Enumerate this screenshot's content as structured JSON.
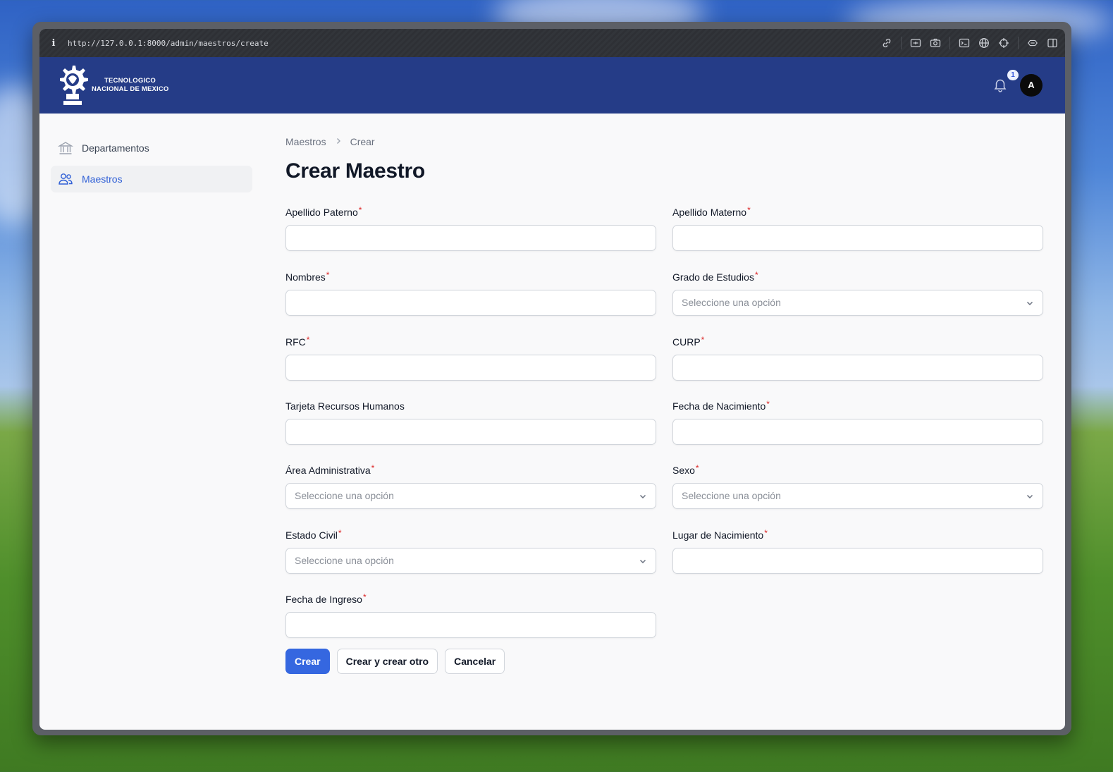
{
  "browser": {
    "url": "http://127.0.0.1:8000/admin/maestros/create",
    "info_icon": "i"
  },
  "header": {
    "logo_line1": "TECNOLOGICO",
    "logo_line2": "NACIONAL DE MEXICO",
    "notification_count": "1",
    "avatar_initial": "A",
    "brand_color": "#253c87"
  },
  "sidebar": {
    "items": [
      {
        "label": "Departamentos",
        "icon": "building-columns-icon",
        "active": false
      },
      {
        "label": "Maestros",
        "icon": "users-icon",
        "active": true
      }
    ]
  },
  "breadcrumb": {
    "parent": "Maestros",
    "current": "Crear"
  },
  "page": {
    "title": "Crear Maestro"
  },
  "form": {
    "fields": [
      {
        "label": "Apellido Paterno",
        "required": true,
        "type": "text",
        "value": ""
      },
      {
        "label": "Apellido Materno",
        "required": true,
        "type": "text",
        "value": ""
      },
      {
        "label": "Nombres",
        "required": true,
        "type": "text",
        "value": ""
      },
      {
        "label": "Grado de Estudios",
        "required": true,
        "type": "select",
        "placeholder": "Seleccione una opción"
      },
      {
        "label": "RFC",
        "required": true,
        "type": "text",
        "value": ""
      },
      {
        "label": "CURP",
        "required": true,
        "type": "text",
        "value": ""
      },
      {
        "label": "Tarjeta Recursos Humanos",
        "required": false,
        "type": "text",
        "value": ""
      },
      {
        "label": "Fecha de Nacimiento",
        "required": true,
        "type": "date",
        "value": ""
      },
      {
        "label": "Área Administrativa",
        "required": true,
        "type": "select",
        "placeholder": "Seleccione una opción"
      },
      {
        "label": "Sexo",
        "required": true,
        "type": "select",
        "placeholder": "Seleccione una opción"
      },
      {
        "label": "Estado Civil",
        "required": true,
        "type": "select",
        "placeholder": "Seleccione una opción"
      },
      {
        "label": "Lugar de Nacimiento",
        "required": true,
        "type": "text",
        "value": ""
      },
      {
        "label": "Fecha de Ingreso",
        "required": true,
        "type": "date",
        "value": ""
      }
    ],
    "required_marker": "*",
    "actions": {
      "create": "Crear",
      "create_another": "Crear y crear otro",
      "cancel": "Cancelar"
    },
    "primary_color": "#3567e0"
  }
}
